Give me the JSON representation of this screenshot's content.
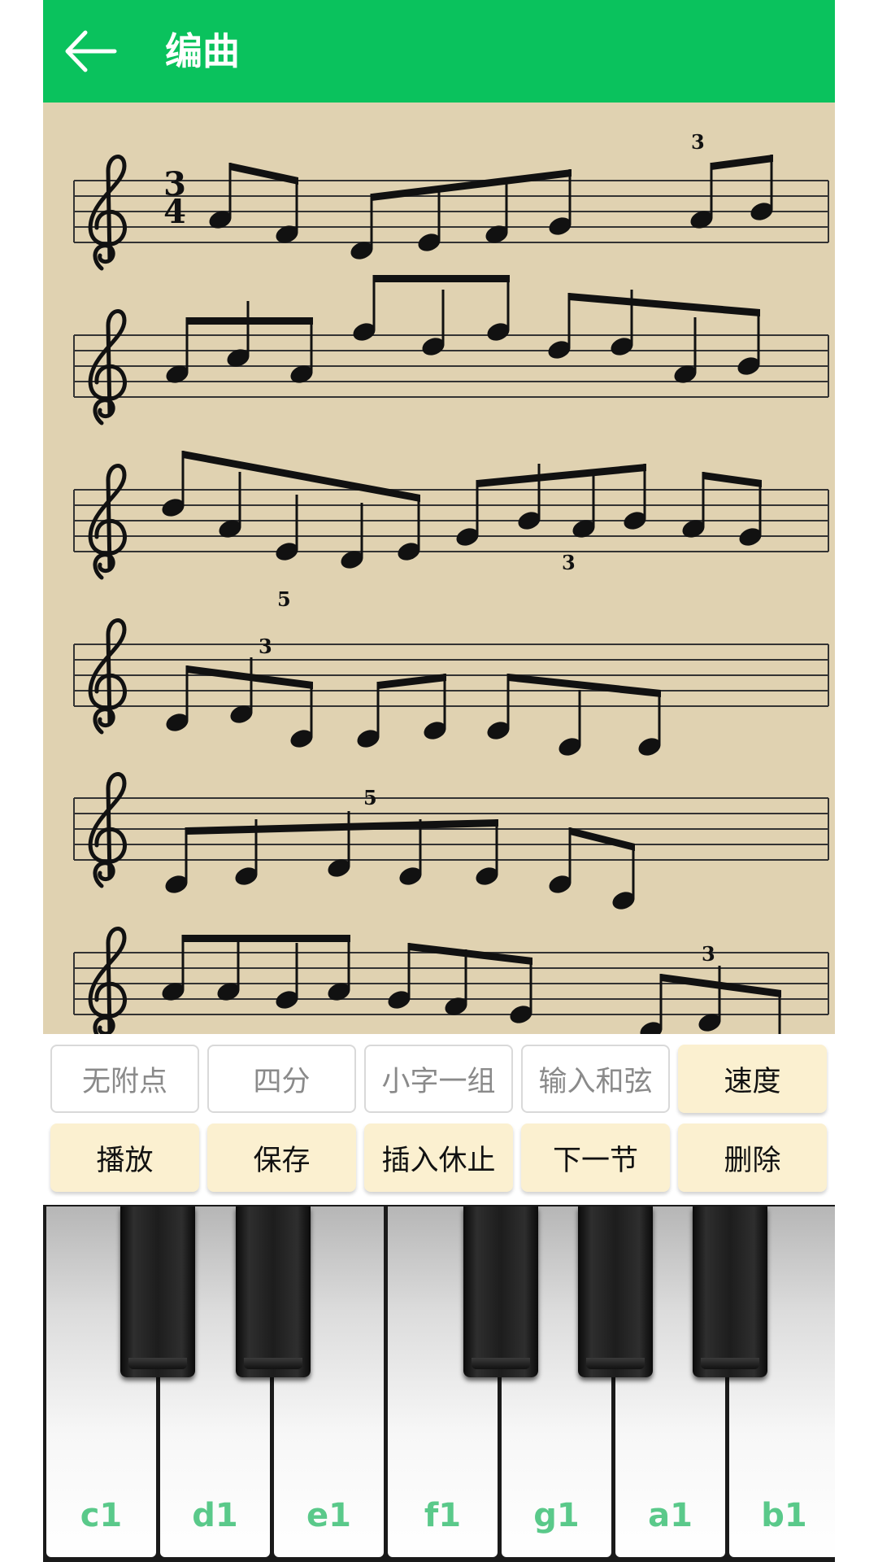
{
  "header": {
    "title": "编曲",
    "back_icon": "arrow-left-icon",
    "background": "#0ac25d"
  },
  "score": {
    "background": "#e0d2b1",
    "time_signature": {
      "top": "3",
      "bottom": "4"
    },
    "tuplet_labels": [
      "3",
      "5",
      "3",
      "3",
      "5",
      "3"
    ]
  },
  "controls": {
    "row1": [
      {
        "label": "无附点",
        "state": "off"
      },
      {
        "label": "四分",
        "state": "off"
      },
      {
        "label": "小字一组",
        "state": "off"
      },
      {
        "label": "输入和弦",
        "state": "off"
      },
      {
        "label": "速度",
        "state": "on"
      }
    ],
    "row2": [
      {
        "label": "播放",
        "state": "on"
      },
      {
        "label": "保存",
        "state": "on"
      },
      {
        "label": "插入休止",
        "state": "on"
      },
      {
        "label": "下一节",
        "state": "on"
      },
      {
        "label": "删除",
        "state": "on"
      }
    ]
  },
  "keyboard": {
    "white_keys": [
      "c1",
      "d1",
      "e1",
      "f1",
      "g1",
      "a1",
      "b1"
    ],
    "label_color": "#5ac98a"
  }
}
